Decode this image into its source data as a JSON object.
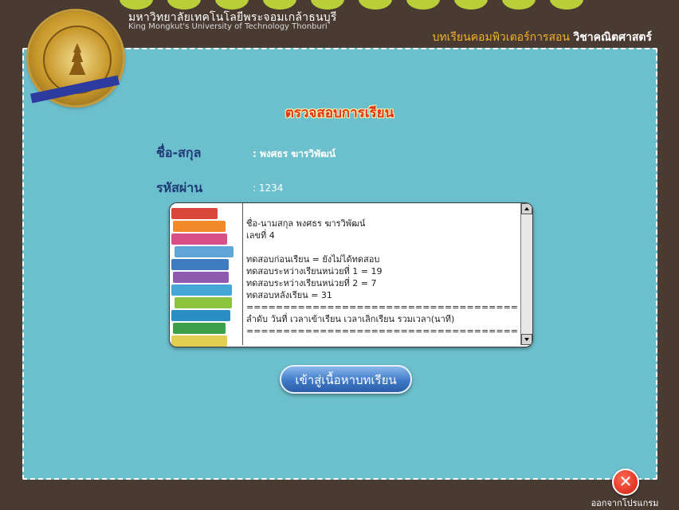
{
  "header": {
    "university_th": "มหาวิทยาลัยเทคโนโลยีพระจอมเกล้าธนบุรี",
    "university_en": "King Mongkut's University of Technology Thonburi",
    "lesson_title_prefix": "บทเรียนคอมพิวเตอร์การสอน ",
    "lesson_title_subject": "วิชาคณิตศาสตร์"
  },
  "page_title": "ตรวจสอบการเรียน",
  "fields": {
    "name_label": "ชื่อ-สกุล",
    "name_value": ": พงศธร  ฆารวิพัฒน์",
    "password_label": "รหัสผ่าน",
    "password_value": ": 1234"
  },
  "report_lines": [
    "ชื่อ-นามสกุล พงศธร  ฆารวิพัฒน์",
    "เลขที่ 4",
    "",
    "ทดสอบก่อนเรียน = ยังไม่ได้ทดสอบ",
    "ทดสอบระหว่างเรียนหน่วยที่ 1  = 19",
    "ทดสอบระหว่างเรียนหน่วยที่ 2 = 7",
    "ทดสอบหลังเรียน = 31",
    "=============================================",
    "ลำดับ วันที่   เวลาเข้าเรียน เวลาเลิกเรียน รวมเวลา(นาที)",
    "============================================="
  ],
  "enter_button_label": "เข้าสู่เนื้อหาบทเรียน",
  "exit": {
    "icon": "close-icon",
    "label": "ออกจากโปรแกรม",
    "color": "#d11c0c"
  },
  "colors": {
    "panel": "#6cbfcc",
    "frame": "#4a3b32",
    "accent": "#b9cf3a",
    "title": "#e3321d"
  }
}
